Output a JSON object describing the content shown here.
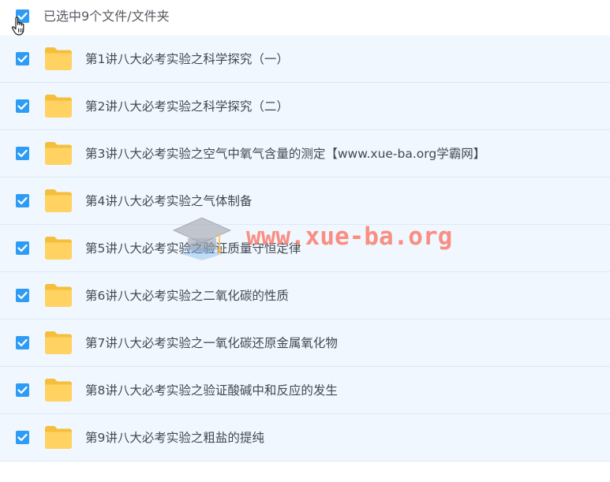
{
  "header": {
    "selection_label": "已选中9个文件/文件夹",
    "select_all_checked": true
  },
  "items": [
    {
      "name": "第1讲八大必考实验之科学探究（一）",
      "checked": true,
      "icon": "folder-icon"
    },
    {
      "name": "第2讲八大必考实验之科学探究（二）",
      "checked": true,
      "icon": "folder-icon"
    },
    {
      "name": "第3讲八大必考实验之空气中氧气含量的测定【www.xue-ba.org学霸网】",
      "checked": true,
      "icon": "folder-icon"
    },
    {
      "name": "第4讲八大必考实验之气体制备",
      "checked": true,
      "icon": "folder-icon"
    },
    {
      "name": "第5讲八大必考实验之验证质量守恒定律",
      "checked": true,
      "icon": "folder-icon"
    },
    {
      "name": "第6讲八大必考实验之二氧化碳的性质",
      "checked": true,
      "icon": "folder-icon"
    },
    {
      "name": "第7讲八大必考实验之一氧化碳还原金属氧化物",
      "checked": true,
      "icon": "folder-icon"
    },
    {
      "name": "第8讲八大必考实验之验证酸碱中和反应的发生",
      "checked": true,
      "icon": "folder-icon"
    },
    {
      "name": "第9讲八大必考实验之粗盐的提纯",
      "checked": true,
      "icon": "folder-icon"
    }
  ],
  "watermark": {
    "text": "www.xue-ba.org"
  },
  "colors": {
    "checkbox": "#2e9cf5",
    "row_background": "#f1f7fe",
    "row_divider": "#dbe9f7",
    "folder": "#ffd261",
    "folder_tab": "#f5bf3c",
    "text": "#424953",
    "watermark": "#fa7668"
  }
}
